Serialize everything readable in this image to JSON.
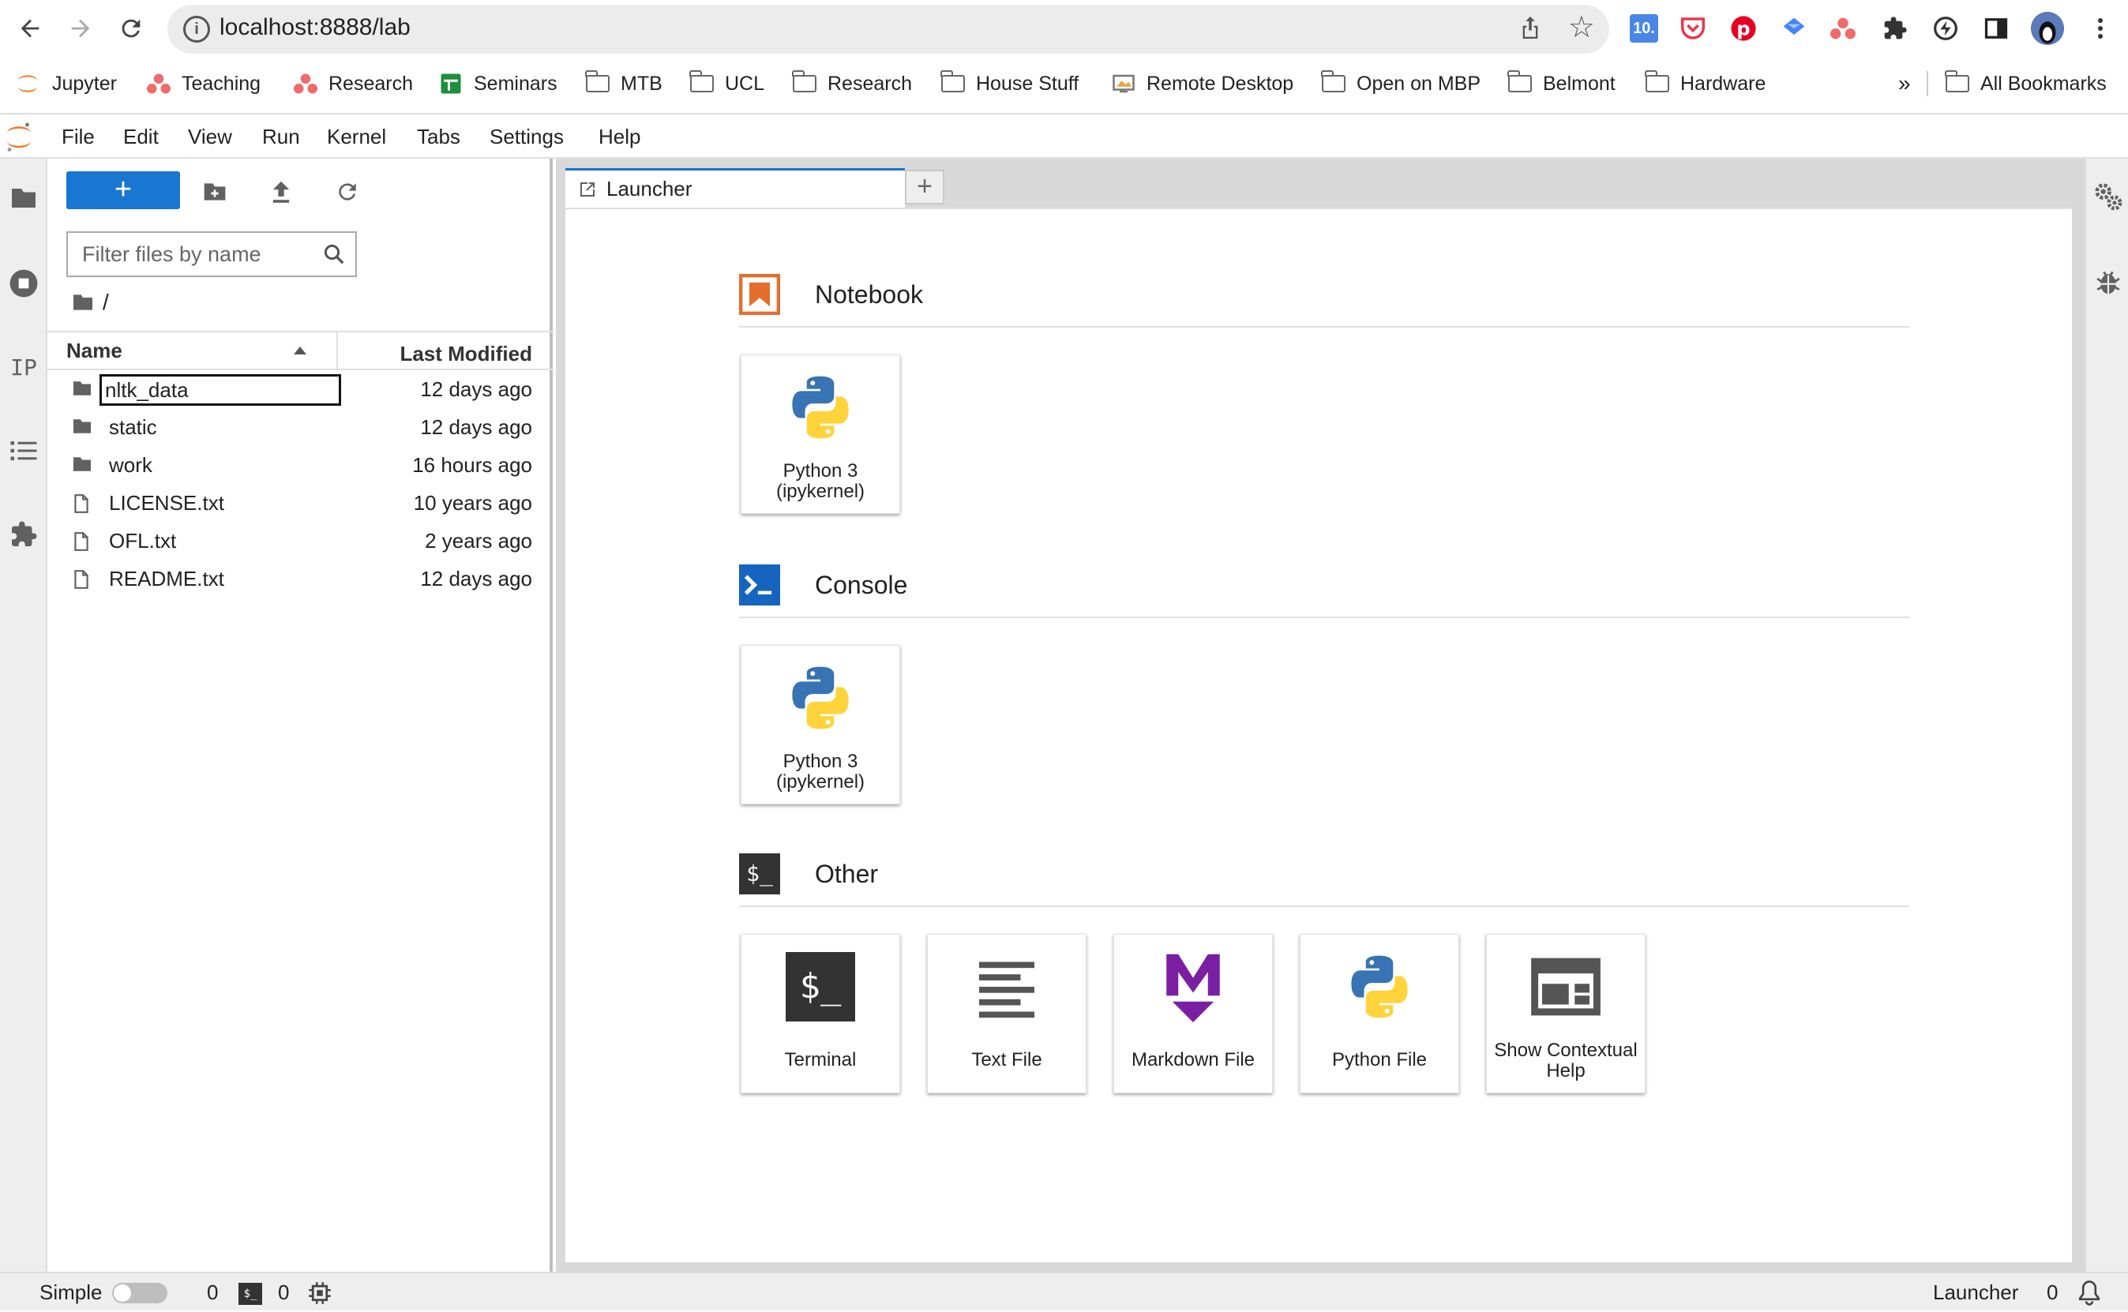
{
  "browser": {
    "url": "localhost:8888/lab",
    "bookmarks": [
      {
        "label": "Jupyter",
        "icon": "jupyter-icon"
      },
      {
        "label": "Teaching",
        "icon": "asana-icon"
      },
      {
        "label": "Research",
        "icon": "asana-icon"
      },
      {
        "label": "Seminars",
        "icon": "sheets-icon"
      },
      {
        "label": "MTB",
        "icon": "folder-icon"
      },
      {
        "label": "UCL",
        "icon": "folder-icon"
      },
      {
        "label": "Research",
        "icon": "folder-icon"
      },
      {
        "label": "House Stuff",
        "icon": "folder-icon"
      },
      {
        "label": "Remote Desktop",
        "icon": "remote-desktop-icon"
      },
      {
        "label": "Open on MBP",
        "icon": "folder-icon"
      },
      {
        "label": "Belmont",
        "icon": "folder-icon"
      },
      {
        "label": "Hardware",
        "icon": "folder-icon"
      }
    ],
    "overflow_label": "»",
    "all_bookmarks_label": "All Bookmarks",
    "extension_badge": "10."
  },
  "menubar": {
    "items": [
      "File",
      "Edit",
      "View",
      "Run",
      "Kernel",
      "Tabs",
      "Settings",
      "Help"
    ]
  },
  "filebrowser": {
    "new_label": "+",
    "filter_placeholder": "Filter files by name",
    "breadcrumb": "/",
    "columns": {
      "name": "Name",
      "modified": "Last Modified"
    },
    "files": [
      {
        "name": "nltk_data",
        "type": "folder",
        "modified": "12 days ago"
      },
      {
        "name": "static",
        "type": "folder",
        "modified": "12 days ago"
      },
      {
        "name": "work",
        "type": "folder",
        "modified": "16 hours ago"
      },
      {
        "name": "LICENSE.txt",
        "type": "file",
        "modified": "10 years ago"
      },
      {
        "name": "OFL.txt",
        "type": "file",
        "modified": "2 years ago"
      },
      {
        "name": "README.txt",
        "type": "file",
        "modified": "12 days ago"
      }
    ]
  },
  "leftbar": {
    "ip_label": "IP"
  },
  "tabs": [
    {
      "label": "Launcher"
    }
  ],
  "tab_add_label": "+",
  "launcher": {
    "sections": [
      {
        "title": "Notebook",
        "cards": [
          {
            "label": "Python 3 (ipykernel)"
          }
        ]
      },
      {
        "title": "Console",
        "cards": [
          {
            "label": "Python 3 (ipykernel)"
          }
        ]
      },
      {
        "title": "Other",
        "cards": [
          {
            "label": "Terminal"
          },
          {
            "label": "Text File"
          },
          {
            "label": "Markdown File"
          },
          {
            "label": "Python File"
          },
          {
            "label": "Show Contextual Help"
          }
        ]
      }
    ],
    "terminal_glyph": "$_"
  },
  "statusbar": {
    "mode_label": "Simple",
    "kernels_count": "0",
    "terminals_count": "0",
    "activity_label": "Launcher",
    "notifications_count": "0"
  },
  "colors": {
    "accent": "#1976d2",
    "notebook_orange": "#e46e2e",
    "console_blue": "#0d47a1",
    "markdown_purple": "#7b1fa2",
    "python_blue": "#3873b3",
    "python_yellow": "#ffd43b"
  }
}
